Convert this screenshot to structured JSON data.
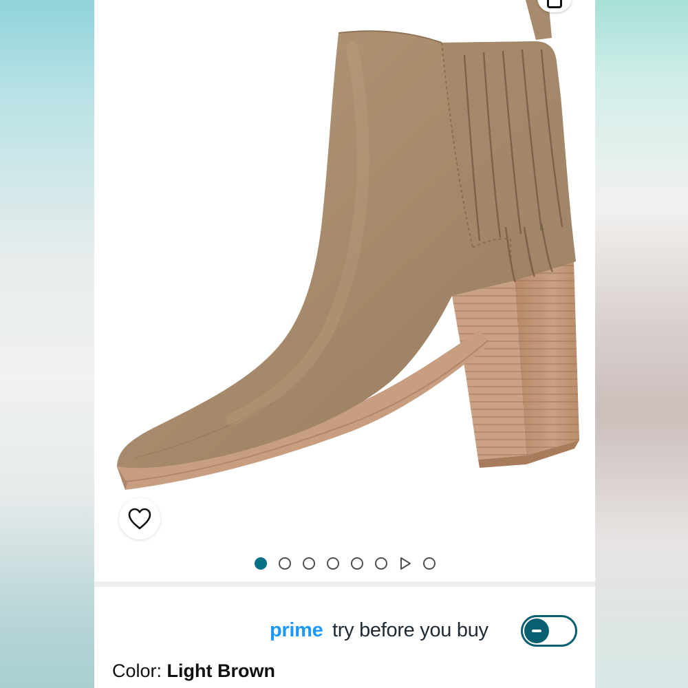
{
  "product": {
    "image_alt": "Light brown suede pointed-toe chelsea ankle boot with stacked block heel",
    "image_count": 8,
    "active_image_index": 0,
    "video_thumbnail_index": 6
  },
  "actions": {
    "share_icon": "share-icon",
    "wishlist_icon": "heart-icon"
  },
  "prime": {
    "brand": "prime",
    "tagline": "try before you buy",
    "toggle_icon": "minus-icon",
    "toggle_state": "on"
  },
  "color": {
    "label": "Color:",
    "value": "Light Brown"
  },
  "colors": {
    "accent": "#077185",
    "prime_blue": "#1a98ff",
    "text": "#0f1111",
    "boot_suede": "#a58a6c",
    "heel_wood": "#c49a7a"
  }
}
